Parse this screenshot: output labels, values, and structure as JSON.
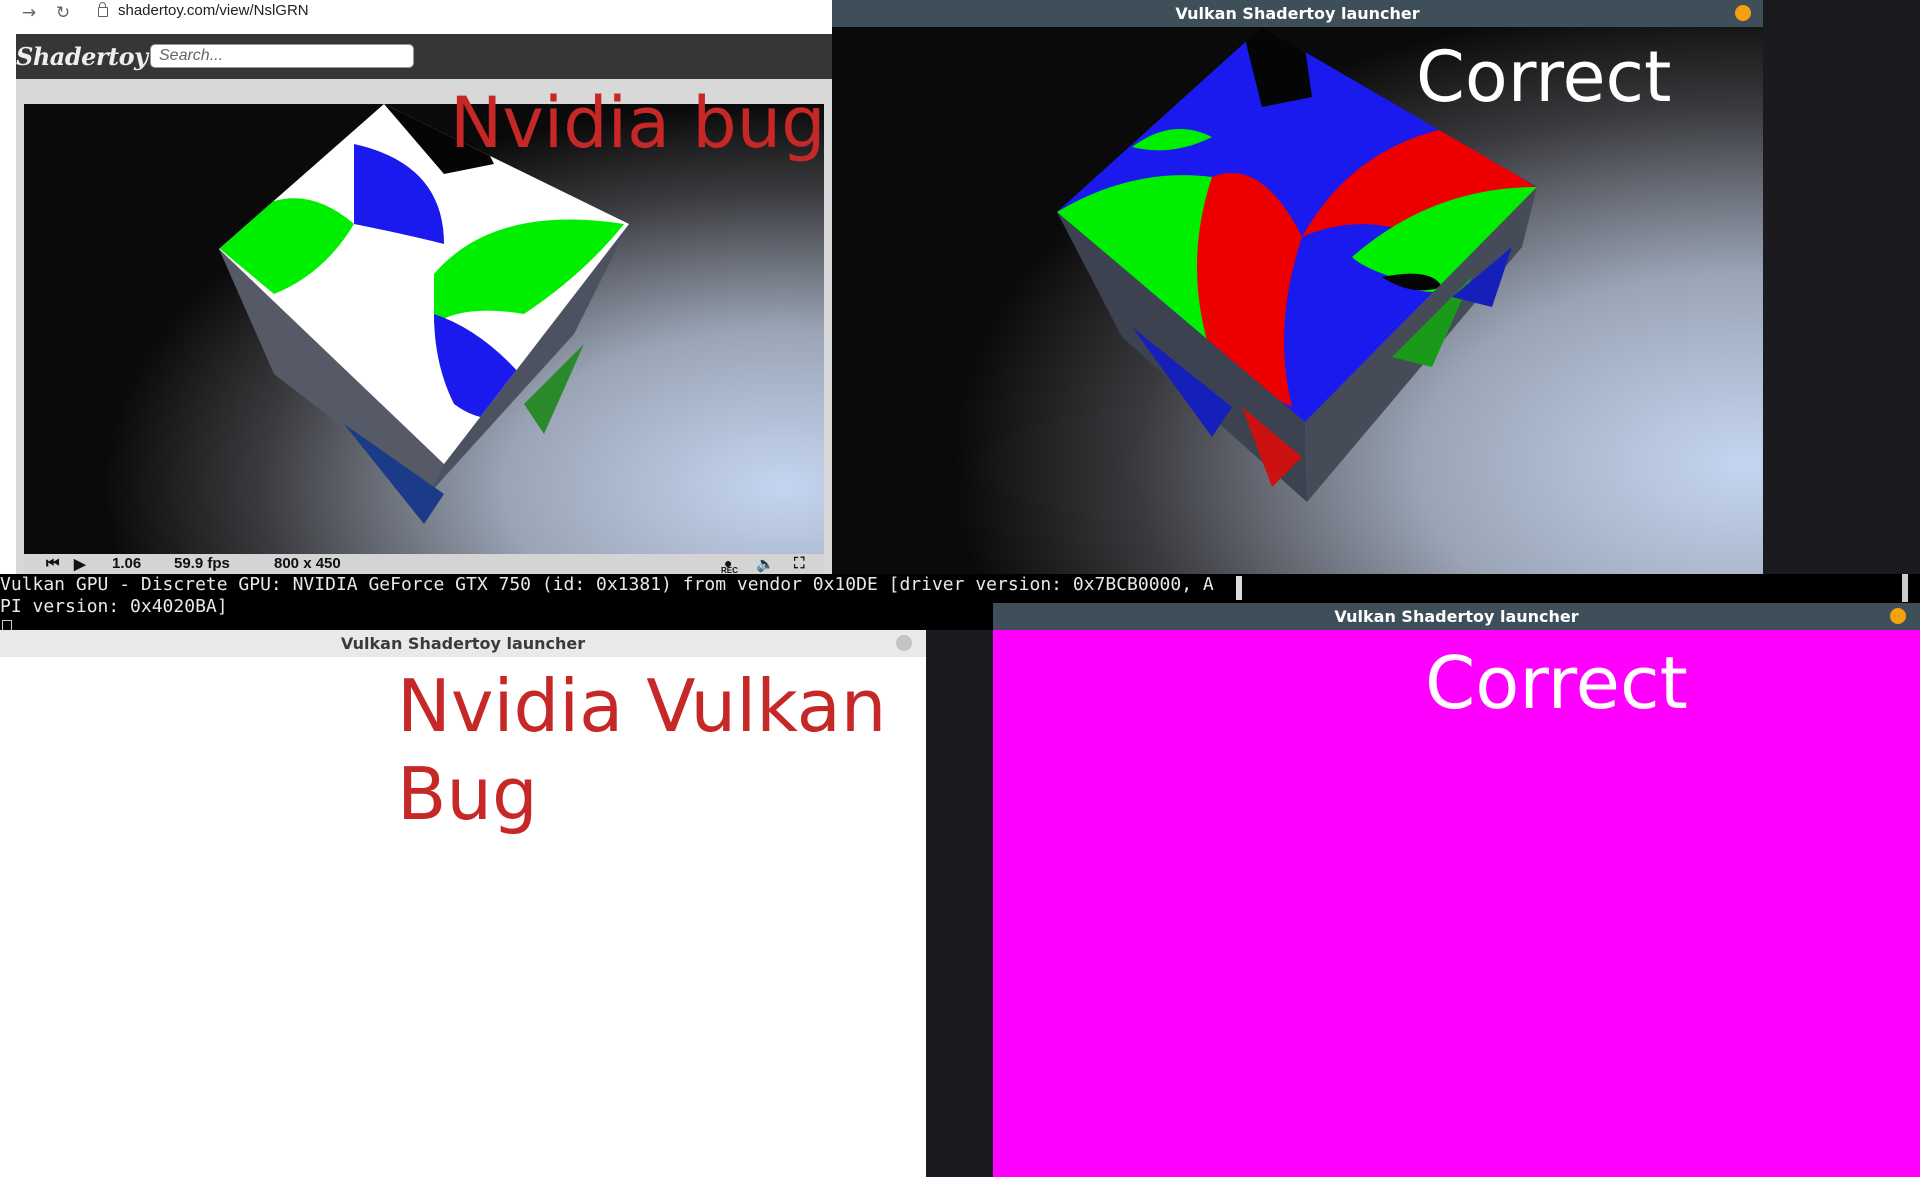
{
  "browser": {
    "url": "shadertoy.com/view/NslGRN",
    "logo": "Shadertoy",
    "search_placeholder": "Search...",
    "overlay_label": "Nvidia bug",
    "controls": {
      "time": "1.06",
      "fps": "59.9 fps",
      "resolution": "800 x 450",
      "rec": "REC"
    }
  },
  "terminal": {
    "line1": "Vulkan GPU - Discrete GPU: NVIDIA GeForce GTX 750 (id: 0x1381) from vendor 0x10DE [driver version: 0x7BCB0000, A",
    "line2": "PI version: 0x4020BA]"
  },
  "window_top_right": {
    "title": "Vulkan Shadertoy launcher",
    "overlay_label": "Correct"
  },
  "window_bottom_left": {
    "title": "Vulkan Shadertoy launcher",
    "overlay_label_line1": "Nvidia Vulkan",
    "overlay_label_line2": "Bug"
  },
  "window_bottom_right": {
    "title": "Vulkan Shadertoy launcher",
    "overlay_label": "Correct"
  },
  "colors": {
    "bug_label": "#c62828",
    "correct_label": "#ffffff",
    "titlebar_dark": "#3f4f5a",
    "close_dot": "#f5a00f",
    "magenta": "#ff00ff"
  },
  "icons": [
    "back-arrow-icon",
    "reload-icon",
    "lock-icon",
    "skip-back-icon",
    "play-icon",
    "record-icon",
    "volume-icon",
    "fullscreen-icon"
  ]
}
